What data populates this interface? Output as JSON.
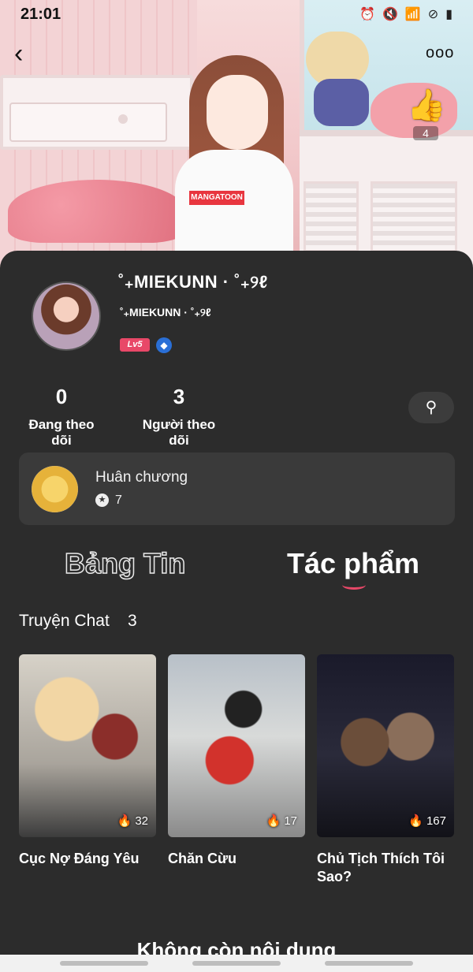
{
  "status_bar": {
    "time": "21:01",
    "icons": [
      "alarm-icon",
      "mute-icon",
      "wifi-icon",
      "dnd-icon",
      "battery-icon"
    ]
  },
  "header": {
    "back_glyph": "‹",
    "more_glyph": "ooo",
    "like_count": "4"
  },
  "profile": {
    "display_name": "˚₊MIEKUNN · ˚₊୨ℓ",
    "username": "˚₊MIEKUNN · ˚₊୨ℓ",
    "level_badge": "Lv5",
    "following_count": "0",
    "following_label": "Đang theo dõi",
    "followers_count": "3",
    "followers_label": "Người theo dõi"
  },
  "medal": {
    "title": "Huân chương",
    "count": "7"
  },
  "tabs": [
    {
      "label": "Bảng Tin",
      "active": false
    },
    {
      "label": "Tác phẩm",
      "active": true
    }
  ],
  "section": {
    "title": "Truyện Chat",
    "count": "3"
  },
  "stories": [
    {
      "title": "Cục Nợ Đáng Yêu",
      "views": "32"
    },
    {
      "title": "Chăn Cừu",
      "views": "17"
    },
    {
      "title": "Chủ Tịch Thích Tôi Sao?",
      "views": "167"
    }
  ],
  "footer": {
    "end_text": "Không còn nội dung"
  },
  "colors": {
    "background": "#2c2c2c",
    "card": "#3a3a3a",
    "accent": "#e84868"
  }
}
